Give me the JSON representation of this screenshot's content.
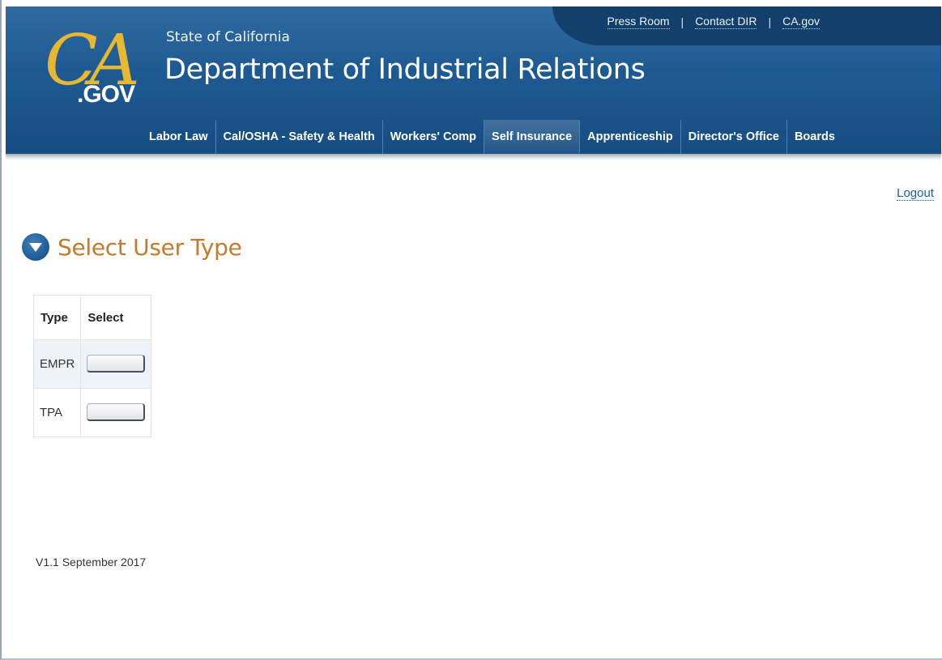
{
  "header": {
    "logo": {
      "ca_text": "CA",
      "gov_text": ".GOV"
    },
    "state_label": "State of California",
    "department_title": "Department of Industrial Relations",
    "utility_links": [
      {
        "label": "Press Room"
      },
      {
        "label": "Contact DIR"
      },
      {
        "label": "CA.gov"
      }
    ],
    "separator": "|",
    "nav": [
      {
        "label": "Labor Law",
        "active": false
      },
      {
        "label": "Cal/OSHA - Safety & Health",
        "active": false
      },
      {
        "label": "Workers' Comp",
        "active": false
      },
      {
        "label": "Self Insurance",
        "active": true
      },
      {
        "label": "Apprenticeship",
        "active": false
      },
      {
        "label": "Director's Office",
        "active": false
      },
      {
        "label": "Boards",
        "active": false
      }
    ]
  },
  "page": {
    "logout_label": "Logout",
    "title": "Select User Type",
    "title_icon": "chevron-down-circle-icon",
    "table": {
      "headers": [
        "Type",
        "Select"
      ],
      "rows": [
        {
          "type": "EMPR",
          "select_label": ""
        },
        {
          "type": "TPA",
          "select_label": ""
        }
      ]
    },
    "version": "V1.1 September 2017"
  },
  "colors": {
    "header_blue": "#1e5a92",
    "title_orange": "#c67a2c",
    "logo_gold": "#e8b830",
    "link_blue": "#1f5da0",
    "row_highlight": "#eef3fa"
  }
}
